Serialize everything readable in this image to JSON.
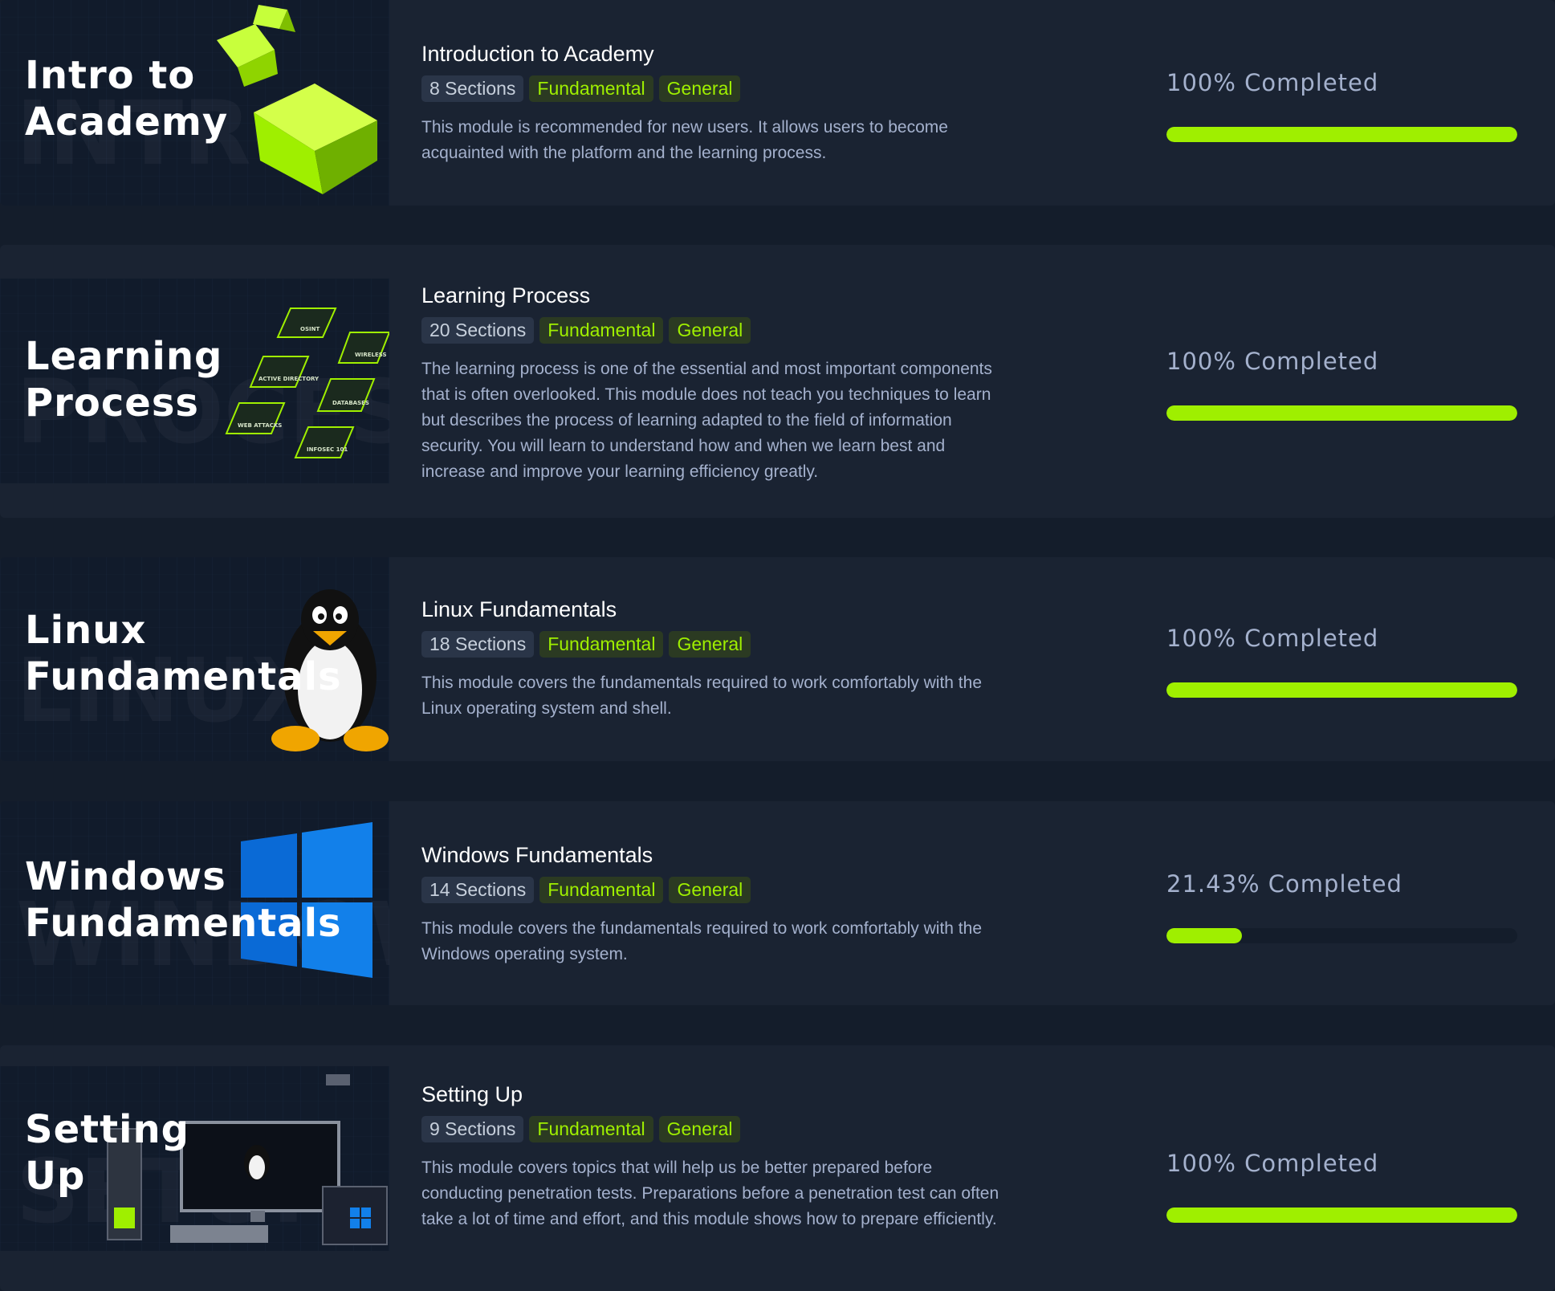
{
  "modules": [
    {
      "thumb_title": "Intro to\nAcademy",
      "title": "Introduction to Academy",
      "sections": "8 Sections",
      "level": "Fundamental",
      "category": "General",
      "description": "This module is recommended for new users. It allows users to become acquainted with the platform and the learning process.",
      "progress_label": "100% Completed",
      "progress": 1.0
    },
    {
      "thumb_title": "Learning\nProcess",
      "title": "Learning Process",
      "sections": "20 Sections",
      "level": "Fundamental",
      "category": "General",
      "description": "The learning process is one of the essential and most important components that is often overlooked. This module does not teach you techniques to learn but describes the process of learning adapted to the field of information security. You will learn to understand how and when we learn best and increase and improve your learning efficiency greatly.",
      "progress_label": "100% Completed",
      "progress": 1.0,
      "thumb_tiles": [
        "OSINT",
        "WIRELESS",
        "ACTIVE DIRECTORY",
        "DATABASES",
        "WEB ATTACKS",
        "INFOSEC 101"
      ]
    },
    {
      "thumb_title": "Linux\nFundamentals",
      "title": "Linux Fundamentals",
      "sections": "18 Sections",
      "level": "Fundamental",
      "category": "General",
      "description": "This module covers the fundamentals required to work comfortably with the Linux operating system and shell.",
      "progress_label": "100% Completed",
      "progress": 1.0
    },
    {
      "thumb_title": "Windows\nFundamentals",
      "title": "Windows Fundamentals",
      "sections": "14 Sections",
      "level": "Fundamental",
      "category": "General",
      "description": "This module covers the fundamentals required to work comfortably with the Windows operating system.",
      "progress_label": "21.43% Completed",
      "progress": 0.2143
    },
    {
      "thumb_title": "Setting\nUp",
      "title": "Setting Up",
      "sections": "9 Sections",
      "level": "Fundamental",
      "category": "General",
      "description": "This module covers topics that will help us be better prepared before conducting penetration tests. Preparations before a penetration test can often take a lot of time and effort, and this module shows how to prepare efficiently.",
      "progress_label": "100% Completed",
      "progress": 1.0
    }
  ],
  "colors": {
    "accent": "#9fef00",
    "page_bg": "#141d2b",
    "card_bg": "#1a2332",
    "text_muted": "#a4b1cd"
  }
}
